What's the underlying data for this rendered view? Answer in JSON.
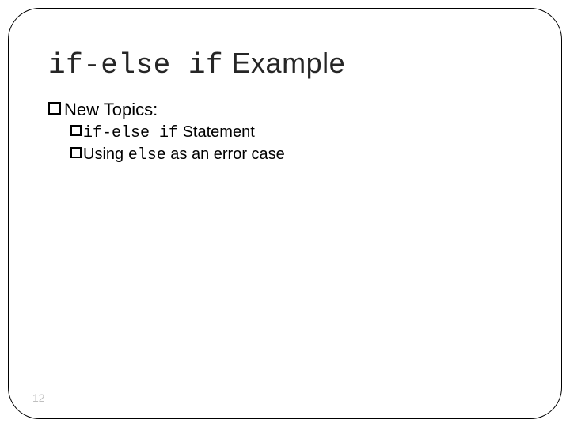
{
  "title": {
    "code": "if-else if",
    "rest": " Example"
  },
  "topics_label": "New Topics:",
  "items": [
    {
      "code": "if-else if",
      "rest": " Statement"
    },
    {
      "prefix": "Using ",
      "code": "else",
      "suffix": " as an error case"
    }
  ],
  "page_number": "12"
}
